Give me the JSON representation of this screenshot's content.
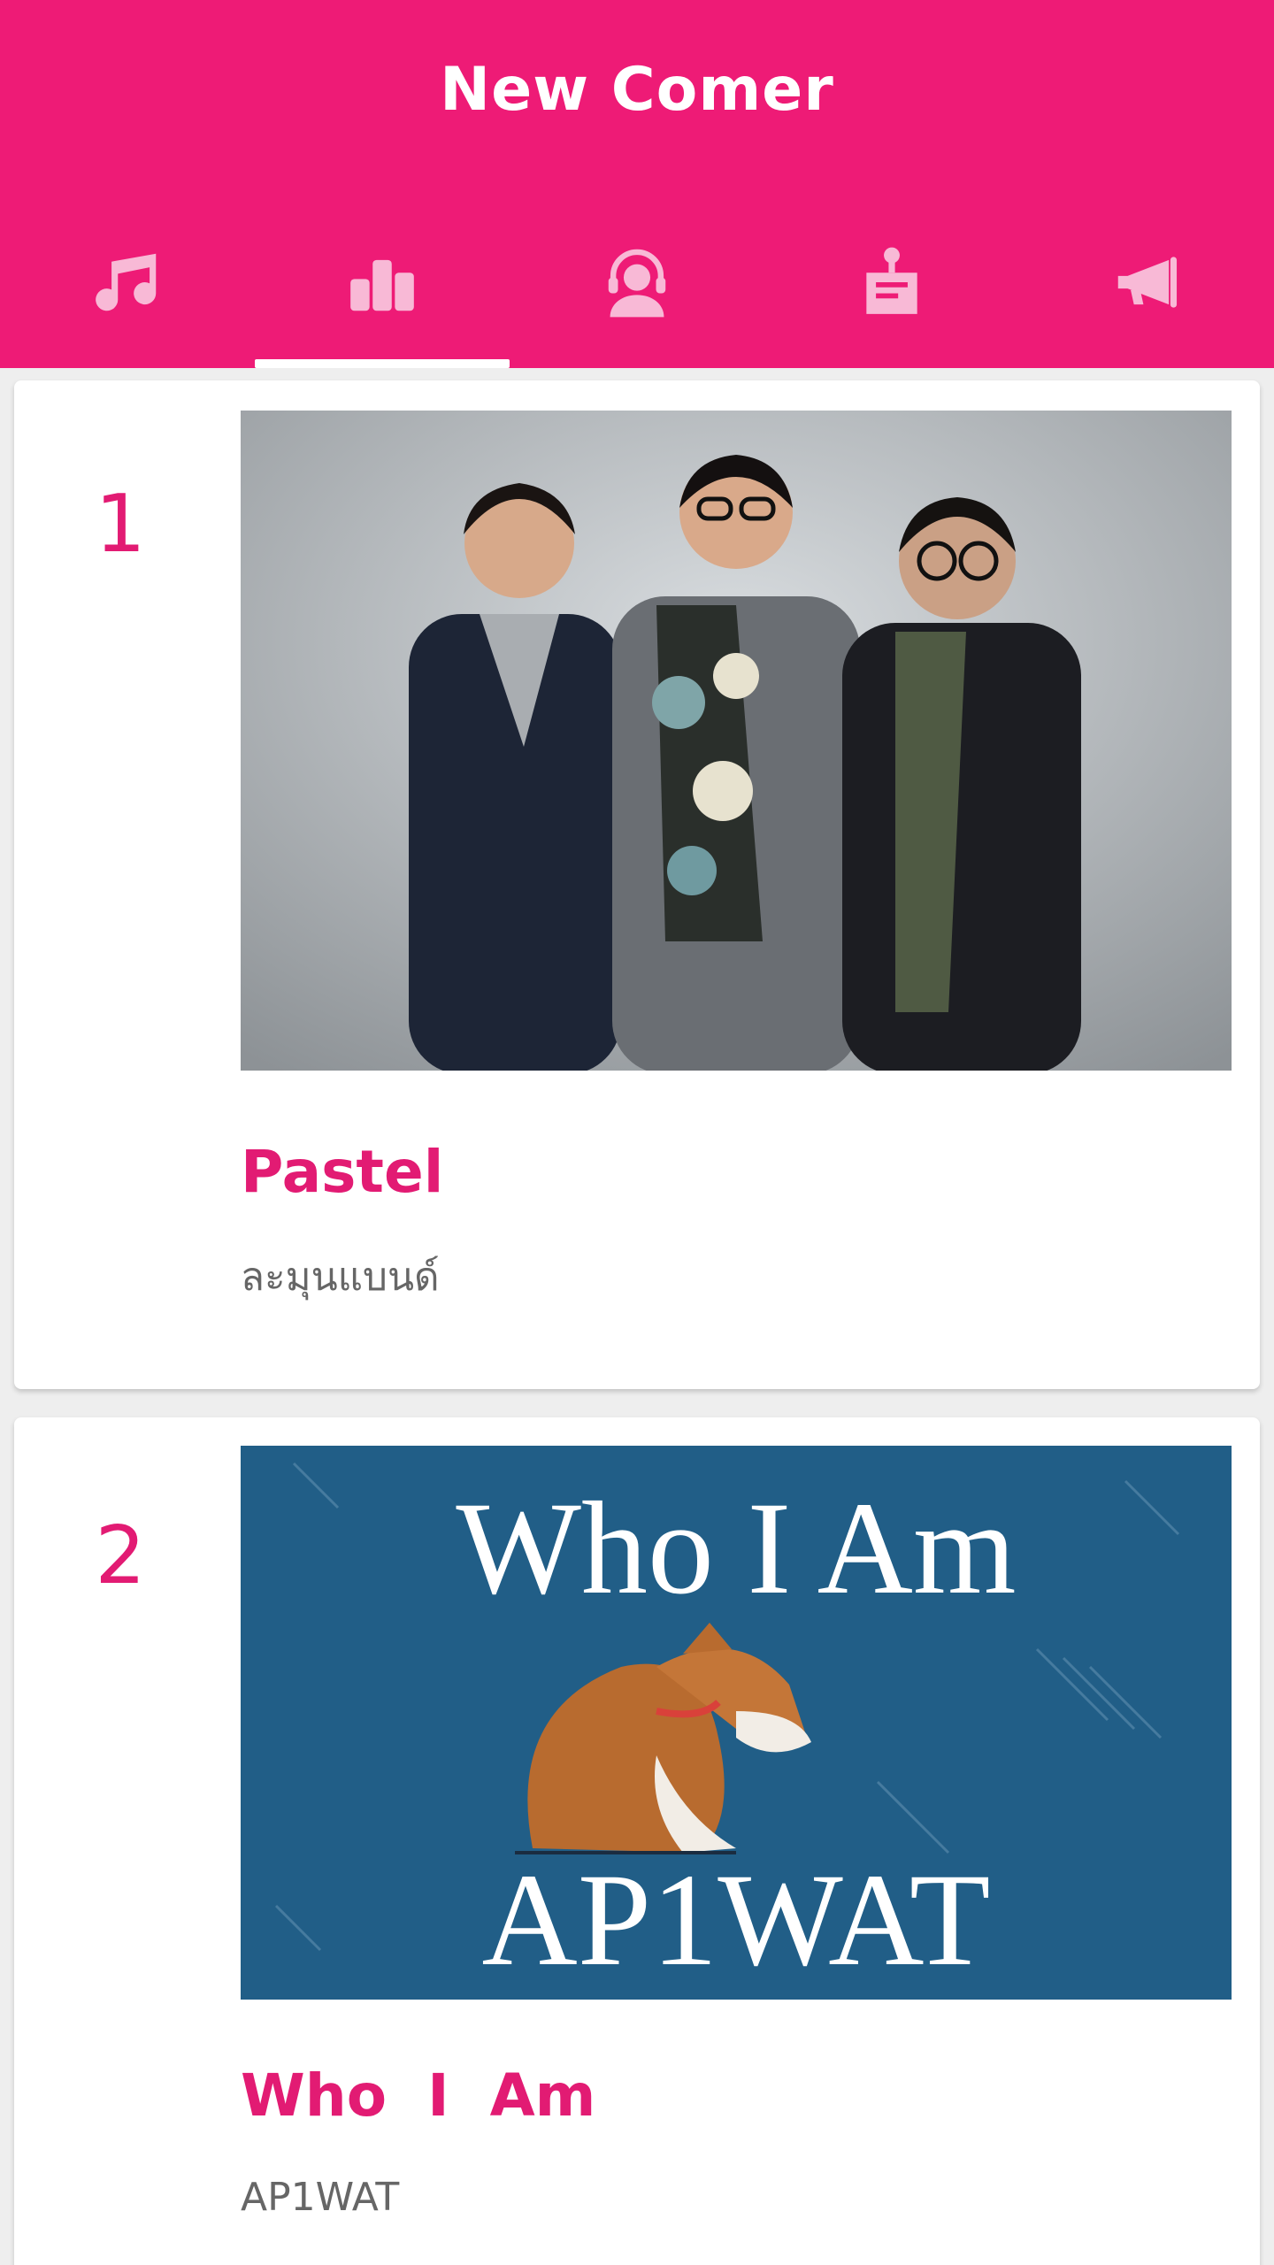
{
  "header": {
    "title": "New Comer",
    "tabs": [
      {
        "icon": "music-note-icon"
      },
      {
        "icon": "bar-chart-icon",
        "selected": true
      },
      {
        "icon": "headset-person-icon"
      },
      {
        "icon": "joystick-clipboard-icon"
      },
      {
        "icon": "megaphone-icon"
      }
    ],
    "color": "#ee1b76",
    "accent": "#e21b73"
  },
  "items": [
    {
      "rank": "1",
      "title": "Pastel",
      "artist": "ละมุนแบนด์"
    },
    {
      "rank": "2",
      "title": "Who  I  Am",
      "artist": "AP1WAT",
      "cover_text_top": "Who I Am",
      "cover_text_bottom": "AP1WAT"
    }
  ]
}
